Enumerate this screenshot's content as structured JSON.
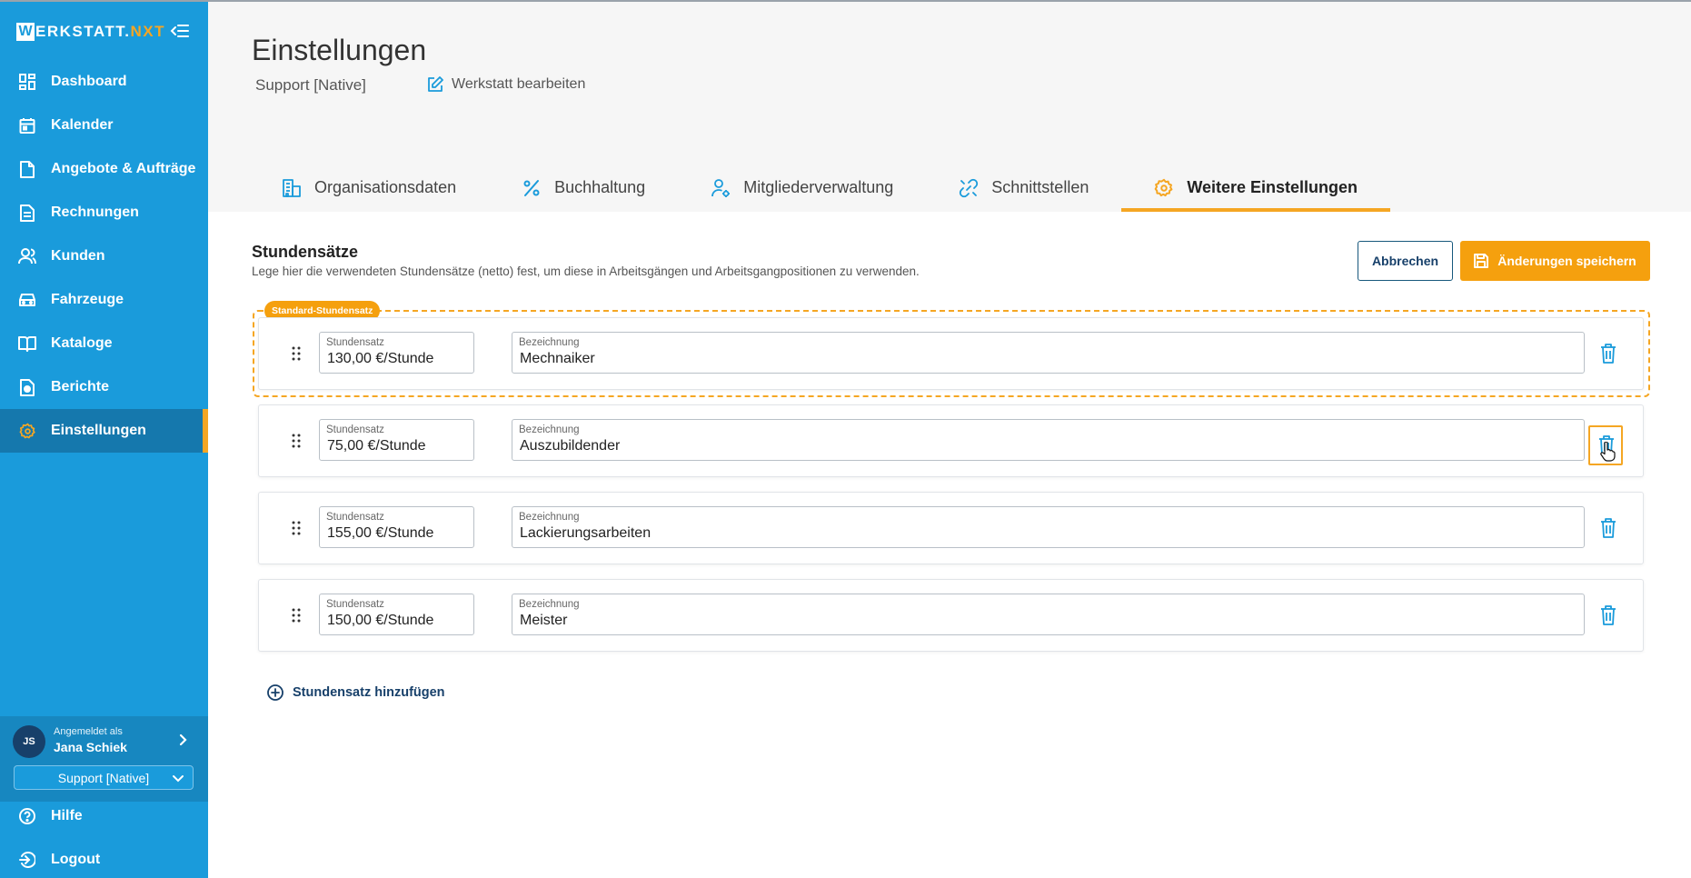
{
  "app": {
    "logo_w": "W",
    "logo_main": "ERKSTATT.",
    "logo_accent": "NXT",
    "colors": {
      "primary": "#1a9bdb",
      "accent": "#f5a623",
      "navy": "#17406a"
    }
  },
  "sidebar": {
    "items": [
      {
        "label": "Dashboard",
        "icon": "dashboard-icon"
      },
      {
        "label": "Kalender",
        "icon": "calendar-icon"
      },
      {
        "label": "Angebote & Aufträge",
        "icon": "document-icon"
      },
      {
        "label": "Rechnungen",
        "icon": "invoice-icon"
      },
      {
        "label": "Kunden",
        "icon": "users-icon"
      },
      {
        "label": "Fahrzeuge",
        "icon": "car-icon"
      },
      {
        "label": "Kataloge",
        "icon": "book-icon"
      },
      {
        "label": "Berichte",
        "icon": "report-icon"
      },
      {
        "label": "Einstellungen",
        "icon": "gear-icon",
        "active": true
      }
    ],
    "user": {
      "initials": "JS",
      "caption": "Angemeldet als",
      "name": "Jana Schiek"
    },
    "org_select": "Support [Native]",
    "bottom": [
      {
        "label": "Hilfe",
        "icon": "help-icon"
      },
      {
        "label": "Logout",
        "icon": "logout-icon"
      }
    ]
  },
  "header": {
    "title": "Einstellungen",
    "org_name": "Support [Native]",
    "edit_label": "Werkstatt bearbeiten",
    "tabs": [
      {
        "label": "Organisationsdaten",
        "icon": "building-icon"
      },
      {
        "label": "Buchhaltung",
        "icon": "percent-icon"
      },
      {
        "label": "Mitgliederverwaltung",
        "icon": "user-gear-icon"
      },
      {
        "label": "Schnittstellen",
        "icon": "link-icon"
      },
      {
        "label": "Weitere Einstellungen",
        "icon": "gear-icon",
        "active": true
      }
    ]
  },
  "section": {
    "title": "Stundensätze",
    "subtitle": "Lege hier die verwendeten Stundensätze (netto) fest, um diese in Arbeitsgängen und Arbeitsgangpositionen zu verwenden.",
    "cancel_label": "Abbrechen",
    "save_label": "Änderungen speichern",
    "standard_badge": "Standard-Stundensatz",
    "rate_field_label": "Stundensatz",
    "name_field_label": "Bezeichnung",
    "rates": [
      {
        "rate": "130,00 €/Stunde",
        "name": "Mechnaiker",
        "standard": true
      },
      {
        "rate": "75,00 €/Stunde",
        "name": "Auszubildender",
        "hovered": true
      },
      {
        "rate": "155,00 €/Stunde",
        "name": "Lackierungsarbeiten"
      },
      {
        "rate": "150,00 €/Stunde",
        "name": "Meister"
      }
    ],
    "add_label": "Stundensatz hinzufügen"
  }
}
